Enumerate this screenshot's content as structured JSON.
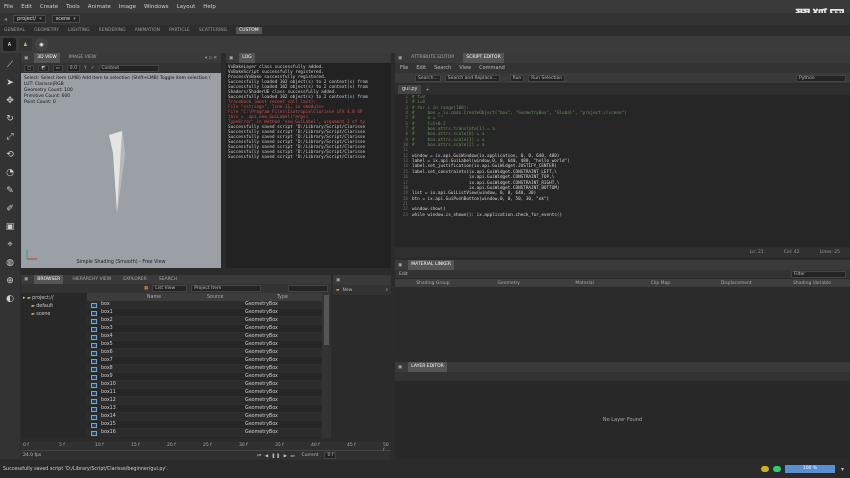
{
  "menubar": {
    "items": [
      "File",
      "Edit",
      "Create",
      "Tools",
      "Animate",
      "Image",
      "Windows",
      "Layout",
      "Help"
    ]
  },
  "project": {
    "path": "project/",
    "scene": "scene"
  },
  "shelf": {
    "tabs": [
      "GENERAL",
      "GEOMETRY",
      "LIGHTING",
      "RENDERING",
      "ANIMATION",
      "PARTICLE",
      "SCATTERING",
      "CUSTOM"
    ],
    "active": "CUSTOM"
  },
  "watermark": "翼狐网",
  "viewport": {
    "tabs": [
      "3D VIEW",
      "IMAGE VIEW"
    ],
    "zoom": "0.0",
    "context": "Context",
    "hud_hint": "Select: Select item (LMB)   Add item to selection (Shift+LMB)   Toggle item selection (",
    "hud_lines": [
      "LUT: Clarisse|RGB",
      "Geometry Count: 100",
      "Primitive Count: 600",
      "Point Count: 0"
    ],
    "footer": "Simple Shading (Smooth) - Free View"
  },
  "log": {
    "title": "LOG",
    "lines": [
      {
        "t": "VxBakeLayer class successfully added.",
        "c": "#d0d0d0"
      },
      {
        "t": "VxBakeScript successfully registered.",
        "c": "#d0d0d0"
      },
      {
        "t": "ProcessVxBake successfully registered.",
        "c": "#d0d0d0"
      },
      {
        "t": "Successfully loaded 102 object(s) to 2 context(s) from",
        "c": "#d0d0d0"
      },
      {
        "t": "Successfully loaded 102 object(s) to 2 context(s) from",
        "c": "#d0d0d0"
      },
      {
        "t": "Shaders/ShaderUE class successfully added.",
        "c": "#d0d0d0"
      },
      {
        "t": "Successfully loaded 102 object(s) to 2 context(s) from",
        "c": "#d0d0d0"
      },
      {
        "t": "Traceback (most recent call last):",
        "c": "#d05050"
      },
      {
        "t": "  File \"<string>\", line 11, in <module>",
        "c": "#d05050"
      },
      {
        "t": "  File \"C:\\Program Files\\Isotropix\\Clarisse iFX 4.0 SP",
        "c": "#d05050"
      },
      {
        "t": "    this = _api.new_GuiLabel(*args)",
        "c": "#d05050"
      },
      {
        "t": "TypeError: in method 'new_GuiLabel', argument 1 of ty",
        "c": "#d05050"
      },
      {
        "t": "Successfully saved script 'D:/Library/Script/Clarisse",
        "c": "#d0d0d0"
      },
      {
        "t": "Successfully saved script 'D:/Library/Script/Clarisse",
        "c": "#d0d0d0"
      },
      {
        "t": "Successfully saved script 'D:/Library/Script/Clarisse",
        "c": "#d0d0d0"
      },
      {
        "t": "Successfully saved script 'D:/Library/Script/Clarisse",
        "c": "#d0d0d0"
      },
      {
        "t": "Successfully saved script 'D:/Library/Script/Clarisse",
        "c": "#d0d0d0"
      },
      {
        "t": "Successfully saved script 'D:/Library/Script/Clarisse",
        "c": "#d0d0d0"
      },
      {
        "t": "Successfully saved script 'D:/Library/Script/Clarisse",
        "c": "#d0d0d0"
      }
    ]
  },
  "script": {
    "tabs": [
      "ATTRIBUTE EDITOR",
      "SCRIPT EDITOR"
    ],
    "menu": [
      "File",
      "Edit",
      "Search",
      "View",
      "Command"
    ],
    "toolbar": [
      "Search...",
      "Search and Replace...",
      "Run",
      "Run Selection"
    ],
    "language": "Python",
    "file": "gui.py",
    "status": [
      "Ln: 21",
      "Col: 42",
      "Lines: 25"
    ],
    "lines": [
      {
        "t": "# t=0",
        "k": "cm"
      },
      {
        "t": "# i=0",
        "k": "cm"
      },
      {
        "t": "# for i in range(100):",
        "k": "cm"
      },
      {
        "t": "#     box = ix.cmds.CreateObject(\"box\", \"GeometryBox\", \"Global\", \"project://scene\")",
        "k": "cm"
      },
      {
        "t": "#     a = \"\"",
        "k": "cm"
      },
      {
        "t": "#     t=t+0.2",
        "k": "cm"
      },
      {
        "t": "#     box.attrs.translate[1] = a",
        "k": "cm"
      },
      {
        "t": "#     box.attrs.scale[0] = a",
        "k": "cm"
      },
      {
        "t": "#     box.attrs.scale[1] = a",
        "k": "cm"
      },
      {
        "t": "#     box.attrs.scale[2] = a",
        "k": "cm"
      },
      {
        "t": "",
        "k": "cm"
      },
      {
        "t": "window = ix.api.GuiWindow(ix.application, 0, 0, 640, 480)",
        "k": "cd"
      },
      {
        "t": "label = ix.api.GuiLabel(window,0, 0, 640, 480, \"hello world\")",
        "k": "cd"
      },
      {
        "t": "label.set_justification(ix.api.GuiWidget.JUSTIFY_CENTER)",
        "k": "cd"
      },
      {
        "t": "label.set_constraints(ix.api.GuiWidget.CONSTRAINT_LEFT,\\",
        "k": "cd"
      },
      {
        "t": "                      ix.api.GuiWidget.CONSTRAINT_TOP,\\",
        "k": "cd"
      },
      {
        "t": "                      ix.api.GuiWidget.CONSTRAINT_RIGHT,\\",
        "k": "cd"
      },
      {
        "t": "                      ix.api.GuiWidget.CONSTRAINT_BOTTOM)",
        "k": "cd"
      },
      {
        "t": "list = ix.api.GuiListView(window, 0, 0, 640, 30)",
        "k": "cd"
      },
      {
        "t": "btn = ix.api.GuiPushButton(window,0, 0, 50, 30, \"ok\")",
        "k": "cd"
      },
      {
        "t": "",
        "k": "cd"
      },
      {
        "t": "window.show()",
        "k": "cd"
      },
      {
        "t": "while window.is_shown(): ix.application.check_for_events()",
        "k": "cd"
      }
    ]
  },
  "material": {
    "title": "MATERIAL LINKER",
    "edit": "Edit",
    "filter": "Filter",
    "columns": [
      "Shading Group",
      "Geometry",
      "Material",
      "Clip Map",
      "Displacement",
      "Shading Variable"
    ]
  },
  "layer": {
    "title": "LAYER EDITOR",
    "empty": "No Layer Found"
  },
  "browser": {
    "tabs": [
      "BROWSER",
      "HIERARCHY VIEW",
      "EXPLORER",
      "SEARCH"
    ],
    "view": "List View",
    "filter": "Project Item",
    "tree": [
      "project://",
      "default",
      "scene"
    ],
    "columns": [
      "Name",
      "Source",
      "Type"
    ],
    "rows": [
      {
        "name": "box",
        "type": "GeometryBox"
      },
      {
        "name": "box1",
        "type": "GeometryBox"
      },
      {
        "name": "box2",
        "type": "GeometryBox"
      },
      {
        "name": "box3",
        "type": "GeometryBox"
      },
      {
        "name": "box4",
        "type": "GeometryBox"
      },
      {
        "name": "box5",
        "type": "GeometryBox"
      },
      {
        "name": "box6",
        "type": "GeometryBox"
      },
      {
        "name": "box7",
        "type": "GeometryBox"
      },
      {
        "name": "box8",
        "type": "GeometryBox"
      },
      {
        "name": "box9",
        "type": "GeometryBox"
      },
      {
        "name": "box10",
        "type": "GeometryBox"
      },
      {
        "name": "box11",
        "type": "GeometryBox"
      },
      {
        "name": "box12",
        "type": "GeometryBox"
      },
      {
        "name": "box13",
        "type": "GeometryBox"
      },
      {
        "name": "box14",
        "type": "GeometryBox"
      },
      {
        "name": "box15",
        "type": "GeometryBox"
      },
      {
        "name": "box16",
        "type": "GeometryBox"
      }
    ]
  },
  "properties": {
    "new_label": "New"
  },
  "timeline": {
    "ticks": [
      "0 f",
      "5 f",
      "10 f",
      "15 f",
      "20 f",
      "25 f",
      "30 f",
      "35 f",
      "40 f",
      "45 f",
      "50 f"
    ],
    "fps": "24.0 fps",
    "current_label": "Current",
    "current": "0 f"
  },
  "statusbar": {
    "message": "Successfully saved script 'D:/Library/Script/Clarisse/beginner/gui.py'.",
    "zoom": "100 %"
  },
  "colors": {
    "accent": "#c0392b",
    "panel": "#2b2b2b",
    "viewport": "#9aa0a6"
  }
}
